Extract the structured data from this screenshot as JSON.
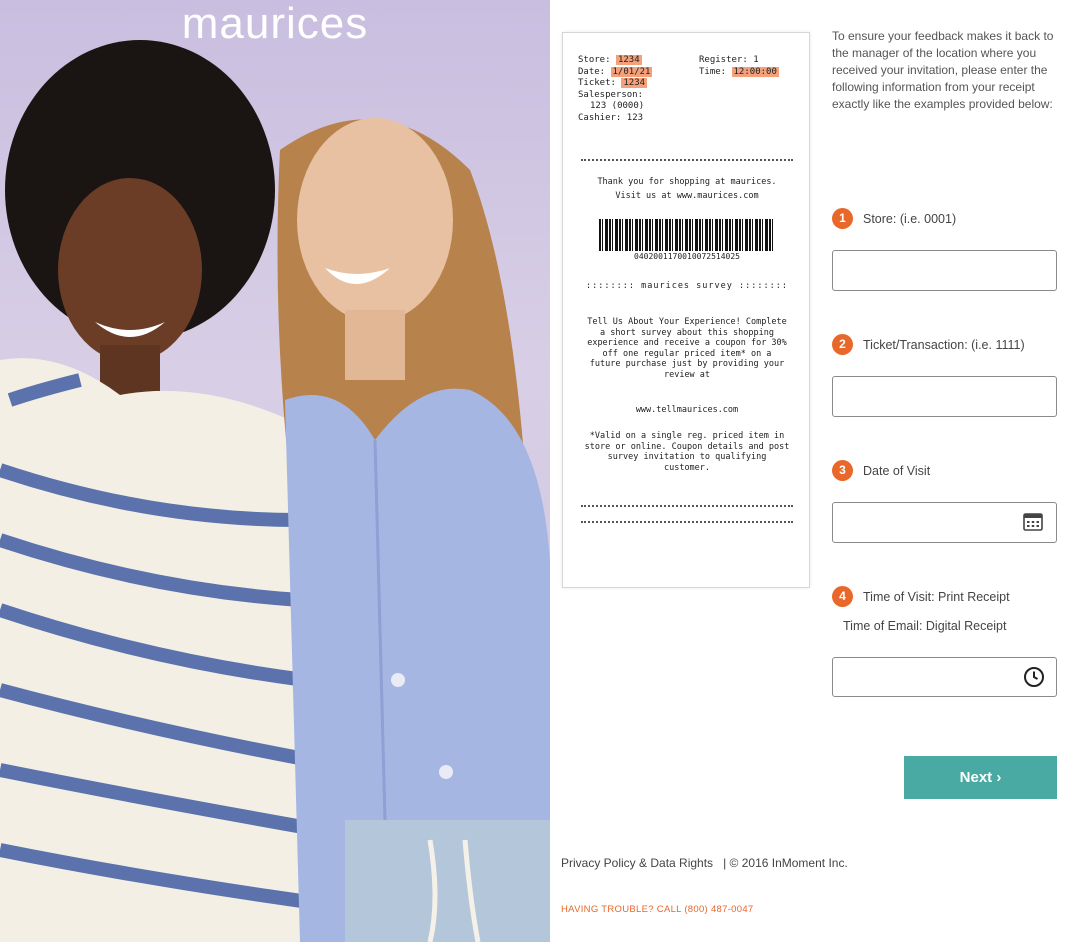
{
  "hero": {
    "brand_logo": "maurices"
  },
  "receipt": {
    "store_label": "Store:",
    "store_value": "1234",
    "date_label": "Date:",
    "date_value": "1/01/21",
    "ticket_label": "Ticket:",
    "ticket_value": "1234",
    "salesperson_label": "Salesperson:",
    "salesperson_value": "123 (0000)",
    "cashier_label": "Cashier:",
    "cashier_value": "123",
    "register_label": "Register:",
    "register_value": "1",
    "time_label": "Time:",
    "time_value": "12:00:00",
    "thanks_line1": "Thank you for shopping at maurices.",
    "thanks_line2": "Visit us at www.maurices.com",
    "barcode_number": "0402001170010072514025",
    "survey_heading": "maurices survey",
    "survey_text": "Tell Us About Your Experience! Complete a short survey about this shopping experience and receive a coupon for 30% off one regular priced item* on a future purchase just by providing your review at",
    "survey_url": "www.tellmaurices.com",
    "disclaimer": "*Valid on a single reg. priced item in store or online. Coupon details and post survey invitation to qualifying customer."
  },
  "instructions": "To ensure your feedback makes it back to the manager of the location where you received your invitation, please enter the following information from your receipt exactly like the examples provided below:",
  "fields": [
    {
      "step": "1",
      "label": "Store: (i.e. 0001)",
      "value": ""
    },
    {
      "step": "2",
      "label": "Ticket/Transaction: (i.e. 1111)",
      "value": ""
    },
    {
      "step": "3",
      "label": "Date of Visit",
      "value": ""
    },
    {
      "step": "4",
      "label": "Time of Visit: Print Receipt",
      "sublabel": "Time of Email: Digital Receipt",
      "value": ""
    }
  ],
  "next_button": "Next ›",
  "footer": {
    "privacy_link": "Privacy Policy & Data Rights",
    "separator": "|",
    "copyright": "© 2016 InMoment Inc."
  },
  "trouble_text": "HAVING TROUBLE? CALL (800) 487-0047",
  "colors": {
    "accent": "#e8672a",
    "button": "#48aaa3"
  },
  "icons": {
    "calendar": "calendar-icon",
    "clock": "clock-icon"
  }
}
